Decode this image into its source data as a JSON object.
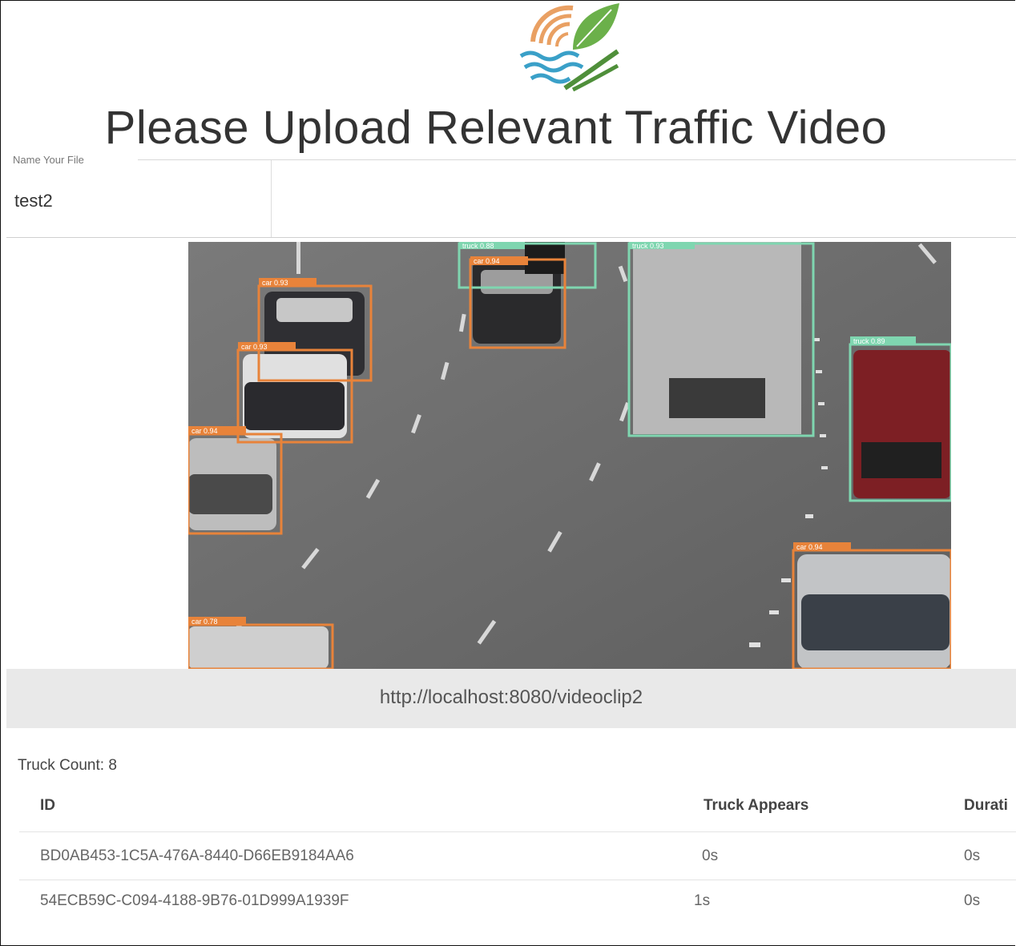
{
  "header": {
    "title": "Please Upload Relevant Traffic Video"
  },
  "file_name": {
    "label": "Name Your File",
    "value": "test2"
  },
  "video": {
    "url": "http://localhost:8080/videoclip2",
    "detections": [
      {
        "label": "car 0.93",
        "kind": "car"
      },
      {
        "label": "car 0.93",
        "kind": "car"
      },
      {
        "label": "truck 0.88",
        "kind": "truck"
      },
      {
        "label": "car 0.94",
        "kind": "car"
      },
      {
        "label": "car 0.94",
        "kind": "car"
      },
      {
        "label": "truck 0.89",
        "kind": "truck"
      },
      {
        "label": "car 0.94",
        "kind": "car"
      },
      {
        "label": "car 0.78",
        "kind": "car"
      },
      {
        "label": "truck 0.93",
        "kind": "truck"
      }
    ],
    "colors": {
      "car": "#e8833a",
      "truck": "#7fd6b0"
    }
  },
  "results": {
    "truck_count": "Truck Count: 8",
    "columns": [
      "ID",
      "Truck Appears",
      "Durati"
    ],
    "rows": [
      {
        "id": "BD0AB453-1C5A-476A-8440-D66EB9184AA6",
        "appears": "0s",
        "duration": "0s"
      },
      {
        "id": "54ECB59C-C094-4188-9B76-01D999A1939F",
        "appears": "1s",
        "duration": "0s"
      }
    ]
  }
}
